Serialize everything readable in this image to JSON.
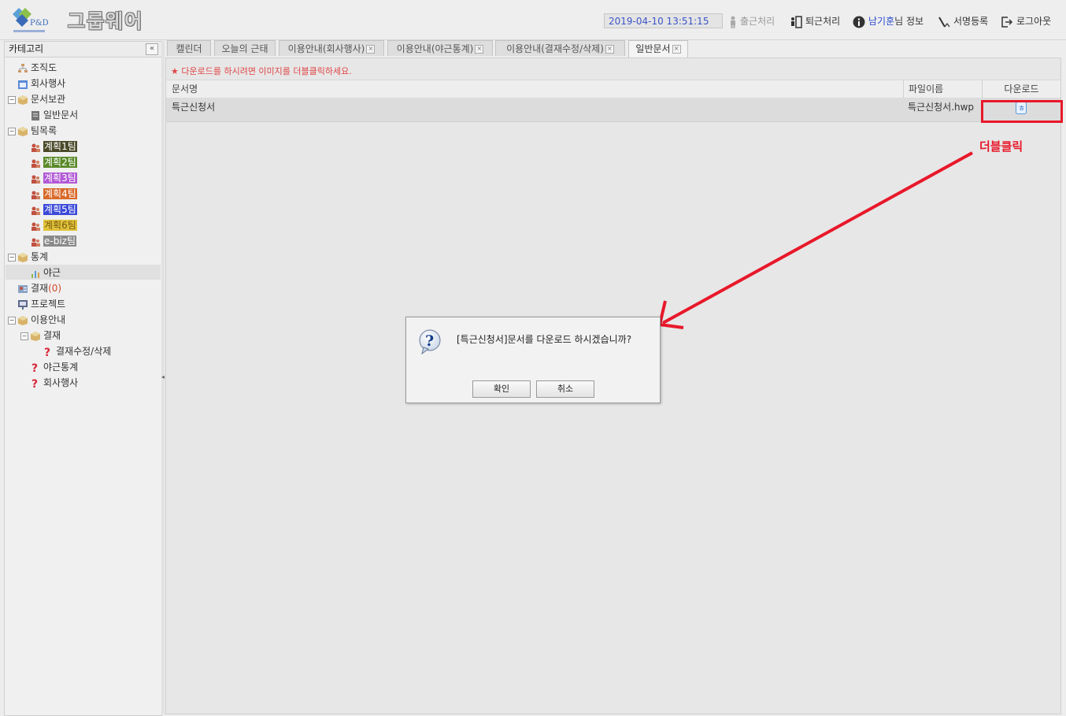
{
  "header": {
    "logo_text": "그룹웨어",
    "datetime": "2019-04-10 13:51:15",
    "checkin_label": "출근처리",
    "checkout_label": "퇴근처리",
    "user_name": "남기훈",
    "user_suffix": "님 정보",
    "sign_label": "서명등록",
    "logout_label": "로그아웃"
  },
  "sidebar": {
    "title": "카테고리",
    "collapse_symbol": "«",
    "items": [
      {
        "label": "조직도"
      },
      {
        "label": "회사행사"
      },
      {
        "label": "문서보관"
      },
      {
        "label": "일반문서"
      },
      {
        "label": "팀목록"
      },
      {
        "label": "계획1팀",
        "color": "#4a4a2a"
      },
      {
        "label": "계획2팀",
        "color": "#5a8a2a"
      },
      {
        "label": "계획3팀",
        "color": "#b259d6"
      },
      {
        "label": "계획4팀",
        "color": "#d96a2a"
      },
      {
        "label": "계획5팀",
        "color": "#3b49d8"
      },
      {
        "label": "계획6팀",
        "color": "#e0c23a"
      },
      {
        "label": "e-biz팀",
        "color": "#8a8a8a"
      },
      {
        "label": "통계"
      },
      {
        "label": "야근"
      },
      {
        "label": "결재",
        "count": "(0)"
      },
      {
        "label": "프로젝트"
      },
      {
        "label": "이용안내"
      },
      {
        "label": "결재"
      },
      {
        "label": "결재수정/삭제"
      },
      {
        "label": "야근통계"
      },
      {
        "label": "회사행사"
      }
    ]
  },
  "tabs": [
    {
      "label": "캘린더"
    },
    {
      "label": "오늘의 근태"
    },
    {
      "label": "이용안내(회사행사)"
    },
    {
      "label": "이용안내(야근통계)"
    },
    {
      "label": "이용안내(결재수정/삭제)"
    },
    {
      "label": "일반문서"
    }
  ],
  "main": {
    "notice": "★ 다운로드를 하시려면 이미지를 더블클릭하세요.",
    "columns": {
      "name": "문서명",
      "file": "파일이름",
      "download": "다운로드"
    },
    "rows": [
      {
        "name": "특근신청서",
        "file": "특근신청서.hwp"
      }
    ]
  },
  "annotation": {
    "label": "더블클릭",
    "color": "#e8182a"
  },
  "dialog": {
    "message": "[특근신청서]문서를 다운로드 하시겠습니까?",
    "ok_label": "확인",
    "cancel_label": "취소"
  }
}
